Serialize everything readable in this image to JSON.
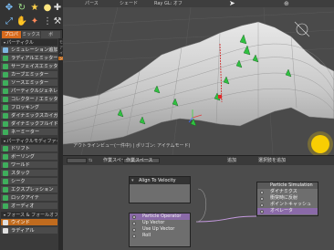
{
  "toolbar": {
    "icons": [
      "move-icon",
      "rotate-icon",
      "star-icon",
      "lightbulb-icon",
      "create-icon",
      "scale-icon",
      "hand-icon",
      "wand-icon",
      "dots-icon",
      "tool-icon"
    ]
  },
  "tabs": [
    "プロパ",
    "ミックス",
    "ボ"
  ],
  "sidebar": {
    "sections": [
      {
        "title": "パーティクル",
        "items": [
          {
            "label": "シミュレーション追加",
            "color": "#7fb6e0"
          },
          {
            "label": "ラディアルエミッター",
            "color": "#3fae5c"
          },
          {
            "label": "サーフェイスエミッター",
            "color": "#3fae5c"
          },
          {
            "label": "カーブエミッター",
            "color": "#3fae5c"
          },
          {
            "label": "ソースエミッター",
            "color": "#3fae5c"
          },
          {
            "label": "パーティクルジェネレータ",
            "color": "#3fae5c"
          },
          {
            "label": "コレクター / エミッター",
            "color": "#3fae5c"
          },
          {
            "label": "フロッキング",
            "color": "#3fae5c"
          },
          {
            "label": "ダイナミックスカイガーデ",
            "color": "#3fae5c"
          },
          {
            "label": "ダイナミックフルイド",
            "color": "#3fae5c"
          },
          {
            "label": "ネーミーター",
            "color": "#3fae5c"
          }
        ]
      },
      {
        "title": "パーティクルモディファイヤ",
        "items": [
          {
            "label": "ドリフト",
            "color": "#3fae5c"
          },
          {
            "label": "ボーリング",
            "color": "#3fae5c"
          },
          {
            "label": "ワールド",
            "color": "#3fae5c"
          },
          {
            "label": "スタック",
            "color": "#3fae5c"
          },
          {
            "label": "シーク",
            "color": "#3fae5c"
          },
          {
            "label": "エクスプレッション",
            "color": "#3fae5c"
          },
          {
            "label": "ロックアイテ",
            "color": "#3fae5c"
          },
          {
            "label": "オーディオ",
            "color": "#3fae5c"
          }
        ]
      },
      {
        "title": "フォース & フォールオフ",
        "items": [
          {
            "label": "ウインド",
            "color": "#e0e0e0",
            "highlight": true
          },
          {
            "label": "ラディアル",
            "color": "#e0e0e0"
          }
        ]
      }
    ],
    "strip_labels": [
      "モ",
      "ア",
      "イ",
      "ン"
    ]
  },
  "viewport": {
    "header": [
      "パース",
      "シェード",
      "Ray GL: オフ"
    ],
    "info": "アウトラインビュー(ー件中) | ポリゴン: アイテムモード)"
  },
  "schematic": {
    "header": {
      "tool_dropdown": "",
      "workspace_label": "作業スペース",
      "workspace_value": "作業スペース",
      "add_button": "追加",
      "add_selected": "選択肢を追加"
    },
    "nodes": {
      "align": {
        "title": "Align To Velocity"
      },
      "operator": {
        "title": "Particle Operator",
        "rows": [
          "Up Vector",
          "Use Up Vector",
          "Roll"
        ]
      },
      "simulation": {
        "title": "Particle Simulation",
        "rows": [
          "ダイナミクス",
          "衝突時に反射",
          "ポイントキャッシュ",
          "オペレータ"
        ]
      }
    }
  },
  "colors": {
    "accent": "#d86a1c",
    "emitter": "#3fae5c",
    "selected_row": "#8a6aa8",
    "link": "#c59ae0"
  }
}
